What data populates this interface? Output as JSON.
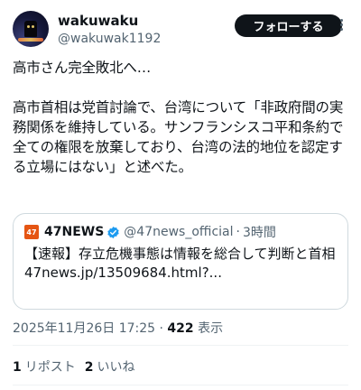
{
  "author": {
    "display_name": "wakuwaku",
    "handle": "@wakuwak1192",
    "avatar": "night-lantern-avatar"
  },
  "follow_label": "フォローする",
  "tweet_text": "高市さん完全敗北へ…\n\n高市首相は党首討論で、台湾について「非政府間の実務関係を維持している。サンフランシスコ平和条約で全ての権限を放棄しており、台湾の法的地位を認定する立場にはない」と述べた。",
  "quote": {
    "logo_text": "47",
    "source_name": "47NEWS",
    "source_handle": "@47news_official",
    "separator": "·",
    "time": "3時間",
    "text": "【速報】存立危機事態は情報を総合して判断と首相",
    "link": "47news.jp/13509684.html?..."
  },
  "meta": {
    "datetime": "2025年11月26日 17:25",
    "separator": "·",
    "views_count": "422",
    "views_label": "表示"
  },
  "stats": {
    "reposts_count": "1",
    "reposts_label": "リポスト",
    "likes_count": "2",
    "likes_label": "いいね"
  },
  "colors": {
    "accent": "#1d9bf0",
    "text": "#0f1419",
    "muted": "#536471",
    "border": "#cfd9de",
    "source_logo": "#e55513"
  }
}
